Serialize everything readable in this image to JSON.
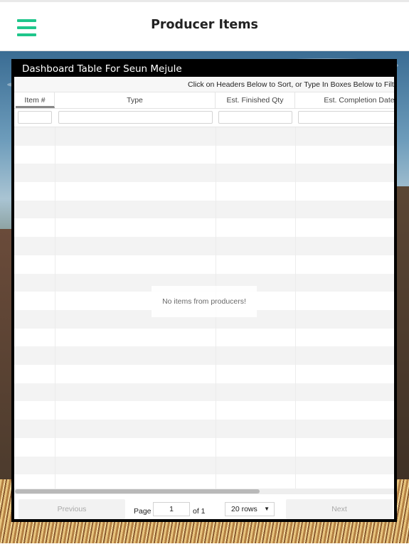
{
  "header": {
    "title": "Producer Items",
    "menu_icon": "hamburger-menu-icon",
    "accent": "#1fc68b"
  },
  "panel": {
    "title": "Dashboard Table For Seun Mejule",
    "instructions": "Click on Headers Below to Sort, or Type In Boxes Below to Filt",
    "columns": [
      "Item #",
      "Type",
      "Est. Finished Qty",
      "Est. Completion Date"
    ],
    "empty_message": "No items from producers!"
  },
  "pager": {
    "previous_label": "Previous",
    "page_label": "Page",
    "page_value": "1",
    "of_label": "of 1",
    "rows_option": "20 rows",
    "next_label": "Next"
  }
}
